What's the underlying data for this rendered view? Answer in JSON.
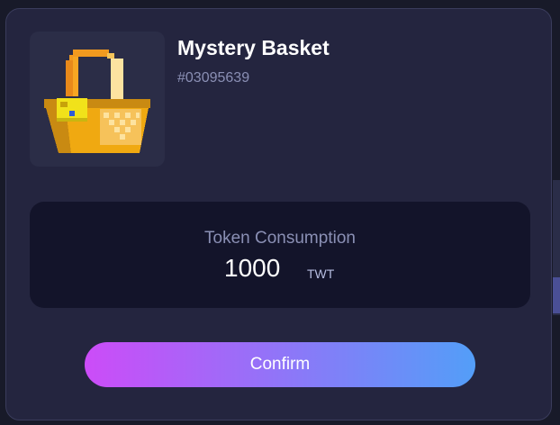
{
  "item": {
    "title": "Mystery Basket",
    "serial": "#03095639",
    "image_icon": "basket-icon"
  },
  "token": {
    "label": "Token Consumption",
    "amount": "1000",
    "unit": "TWT"
  },
  "actions": {
    "confirm_label": "Confirm"
  },
  "colors": {
    "modal_bg": "#24253f",
    "token_box_bg": "#13142a",
    "button_gradient_start": "#cc4cf8",
    "button_gradient_end": "#539ef8"
  }
}
